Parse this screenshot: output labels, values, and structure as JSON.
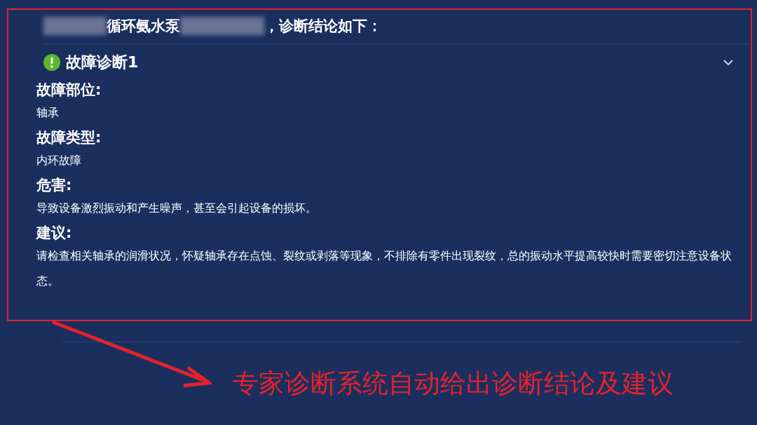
{
  "header": {
    "title_parts": [
      {
        "kind": "redacted"
      },
      {
        "kind": "text",
        "text": "循环氨水泵"
      },
      {
        "kind": "redacted"
      },
      {
        "kind": "text",
        "text": "，诊断结论如下："
      }
    ]
  },
  "diagnosis": {
    "title": "故障诊断1",
    "expanded": true,
    "fields": [
      {
        "label": "故障部位:",
        "value": "轴承"
      },
      {
        "label": "故障类型:",
        "value": "内环故障"
      },
      {
        "label": "危害:",
        "value": "导致设备激烈振动和产生噪声，甚至会引起设备的损坏。"
      },
      {
        "label": "建议:",
        "value": "请检查相关轴承的润滑状况，怀疑轴承存在点蚀、裂纹或剥落等现象，不排除有零件出现裂纹，总的振动水平提高较快时需要密切注意设备状态。"
      }
    ]
  },
  "annotation": {
    "text": "专家诊断系统自动给出诊断结论及建议"
  }
}
